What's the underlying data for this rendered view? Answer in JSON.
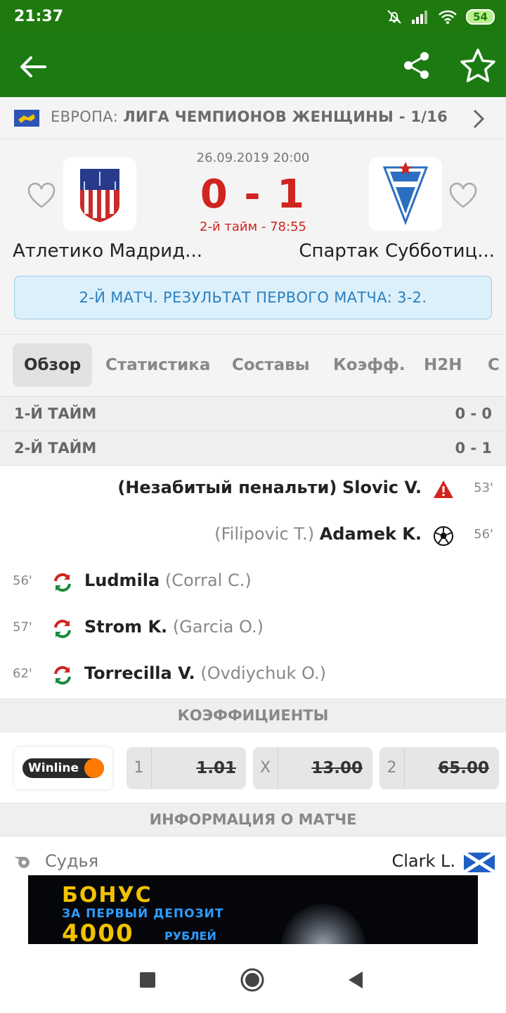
{
  "status_bar": {
    "time": "21:37",
    "battery": "54"
  },
  "league": {
    "prefix": "ЕВРОПА:",
    "name": "ЛИГА ЧЕМПИОНОВ ЖЕНЩИНЫ - 1/16"
  },
  "match": {
    "datetime": "26.09.2019 20:00",
    "score": "0 - 1",
    "period": "2-й тайм - 78:55",
    "home": "Атлетико Мадрид...",
    "away": "Спартак Субботиц...",
    "notice": "2-Й МАТЧ. РЕЗУЛЬТАТ ПЕРВОГО МАТЧА: 3-2."
  },
  "tabs": [
    "Обзор",
    "Статистика",
    "Составы",
    "Коэфф.",
    "H2H",
    "С"
  ],
  "halves": [
    {
      "label": "1-Й ТАЙМ",
      "score": "0 - 0"
    },
    {
      "label": "2-Й ТАЙМ",
      "score": "0 - 1"
    }
  ],
  "events": [
    {
      "side": "away",
      "minute": "53'",
      "main": "Slovic V.",
      "sub": "(Незабитый пенальти)",
      "icon": "missed-penalty-icon"
    },
    {
      "side": "away",
      "minute": "56'",
      "main": "Adamek K.",
      "sub": "(Filipovic T.)",
      "icon": "goal-ball-icon"
    },
    {
      "side": "home",
      "minute": "56'",
      "main": "Ludmila",
      "sub": "(Corral C.)",
      "icon": "substitution-icon"
    },
    {
      "side": "home",
      "minute": "57'",
      "main": "Strom K.",
      "sub": "(Garcia O.)",
      "icon": "substitution-icon"
    },
    {
      "side": "home",
      "minute": "62'",
      "main": "Torrecilla V.",
      "sub": "(Ovdiychuk O.)",
      "icon": "substitution-icon"
    }
  ],
  "odds_section": {
    "title": "КОЭФФИЦИЕНТЫ",
    "bookmaker": "Winline",
    "items": [
      {
        "key": "1",
        "value": "1.01"
      },
      {
        "key": "X",
        "value": "13.00"
      },
      {
        "key": "2",
        "value": "65.00"
      }
    ]
  },
  "info_section": {
    "title": "ИНФОРМАЦИЯ О МАТЧЕ",
    "referee_label": "Судья",
    "referee_name": "Clark L."
  },
  "banner": {
    "line1": "БОНУС",
    "line2": "ЗА ПЕРВЫЙ ДЕПОЗИТ",
    "line3": "4000",
    "line4": "РУБЛЕЙ"
  },
  "colors": {
    "brand_green": "#1b7b12",
    "score_red": "#d0241f",
    "notice_blue": "#2a7fbf"
  }
}
